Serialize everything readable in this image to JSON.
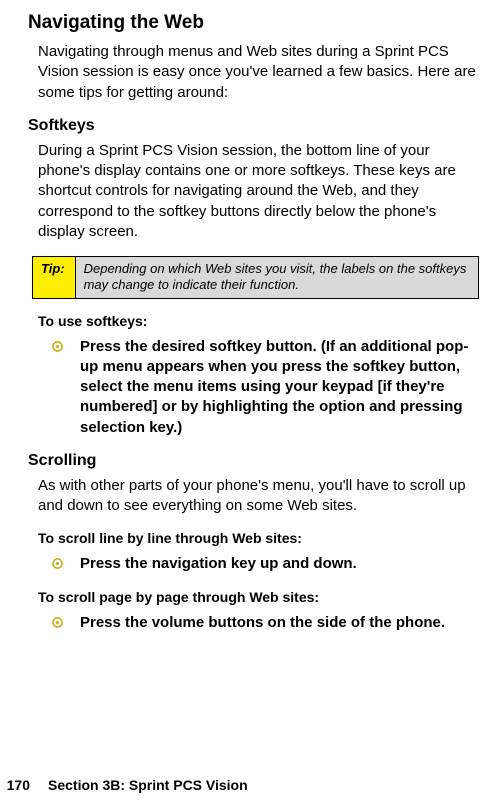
{
  "h1": "Navigating the Web",
  "intro": "Navigating through menus and Web sites during a Sprint PCS Vision session is easy once you've learned a few basics. Here are some tips for getting around:",
  "softkeys": {
    "heading": "Softkeys",
    "body": "During a Sprint PCS Vision session, the bottom line of your phone's display contains one or more softkeys. These keys are shortcut controls for navigating around the Web, and they correspond to the softkey buttons directly below the phone's display screen.",
    "tip_label": "Tip:",
    "tip_text": "Depending on which Web sites you visit, the labels on the softkeys may change to indicate their function.",
    "use_heading": "To use softkeys:",
    "use_bullet": "Press the desired softkey button. (If an additional pop-up menu appears when you press the softkey button, select the menu items using your keypad [if they're numbered] or by highlighting the option and pressing selection key.)"
  },
  "scrolling": {
    "heading": "Scrolling",
    "body": "As with other parts of your phone's menu, you'll have to scroll up and down to see everything on some Web sites.",
    "line_heading": "To scroll line by line through Web sites:",
    "line_bullet": "Press the navigation key up and down.",
    "page_heading": "To scroll page by page through Web sites:",
    "page_bullet": "Press the volume buttons on the side of the phone."
  },
  "footer": {
    "page_number": "170",
    "section": "Section 3B: Sprint PCS Vision"
  }
}
